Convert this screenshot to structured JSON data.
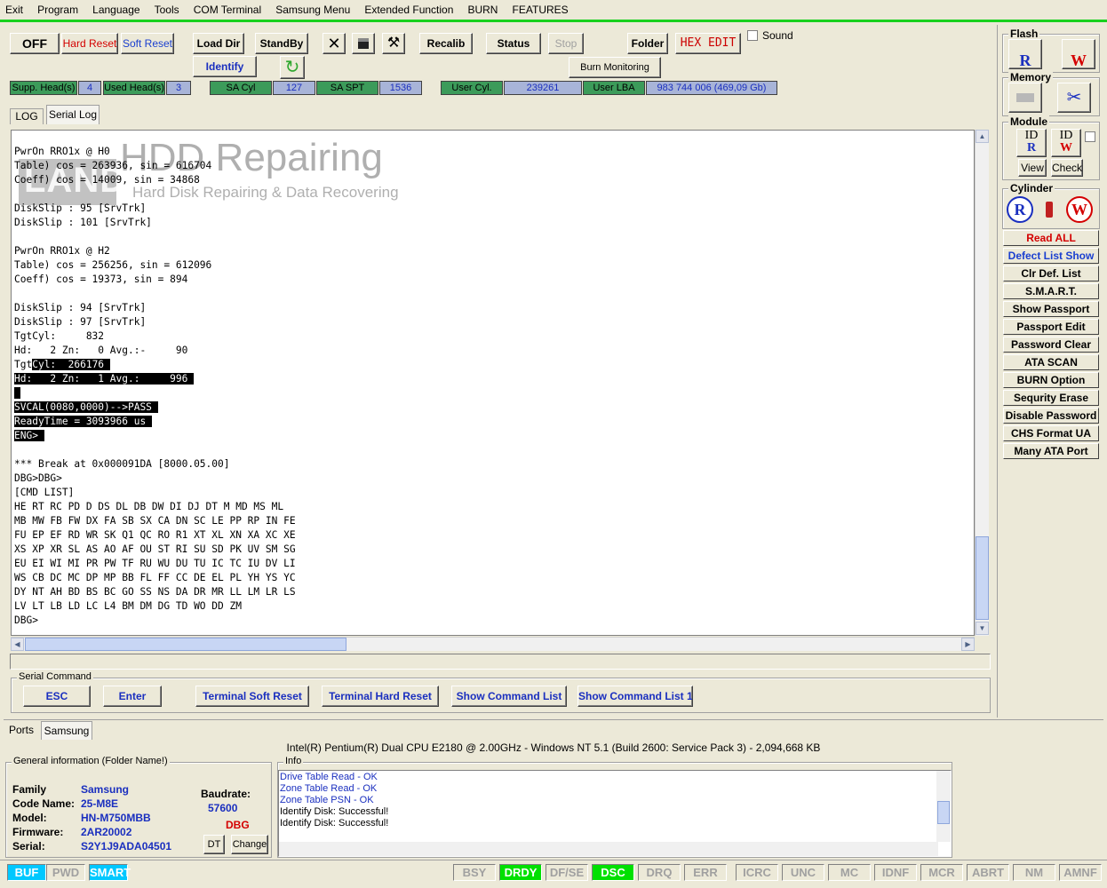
{
  "menu": [
    "Exit",
    "Program",
    "Language",
    "Tools",
    "COM Terminal",
    "Samsung Menu",
    "Extended Function",
    "BURN",
    "FEATURES"
  ],
  "toolbar": {
    "off": "OFF",
    "hard_reset": "Hard Reset",
    "soft_reset": "Soft Reset",
    "load_dir": "Load Dir",
    "identify": "Identify",
    "standby": "StandBy",
    "recalib": "Recalib",
    "status": "Status",
    "stop": "Stop",
    "folder": "Folder",
    "hex_edit": "HEX EDIT",
    "burn_monitoring": "Burn Monitoring",
    "sound": "Sound"
  },
  "params": {
    "supp_heads_label": "Supp. Head(s)",
    "supp_heads": "4",
    "used_heads_label": "Used Head(s)",
    "used_heads": "3",
    "sa_cyl_label": "SA Cyl",
    "sa_cyl": "127",
    "sa_spt_label": "SA SPT",
    "sa_spt": "1536",
    "user_cyl_label": "User Cyl.",
    "user_cyl": "239261",
    "user_lba_label": "User LBA",
    "user_lba": "983 744 006  (469,09 Gb)"
  },
  "tabs": {
    "log": "LOG",
    "serial_log": "Serial Log",
    "ports": "Ports",
    "samsung": "Samsung"
  },
  "watermark": {
    "line1": "HDD Repairing",
    "line2": "Hard Disk Repairing & Data Recovering",
    "logo": "LAND"
  },
  "terminal": [
    {
      "t": "PwrOn RRO1x @ H0"
    },
    {
      "t": "Table) cos = 263936, sin = 616704"
    },
    {
      "t": "Coeff) cos = 14009, sin = 34868"
    },
    {
      "t": ""
    },
    {
      "t": "DiskSlip : 95 [SrvTrk]"
    },
    {
      "t": "DiskSlip : 101 [SrvTrk]"
    },
    {
      "t": ""
    },
    {
      "t": "PwrOn RRO1x @ H2"
    },
    {
      "t": "Table) cos = 256256, sin = 612096"
    },
    {
      "t": "Coeff) cos = 19373, sin = 894"
    },
    {
      "t": ""
    },
    {
      "t": "DiskSlip : 94 [SrvTrk]"
    },
    {
      "t": "DiskSlip : 97 [SrvTrk]"
    },
    {
      "t": "TgtCyl:     832"
    },
    {
      "t": "Hd:   2 Zn:   0 Avg.:-     90"
    },
    {
      "pre": "Tgt",
      "t": "Cyl:  266176 "
    },
    {
      "pre": "",
      "t": "Hd:   2 Zn:   1 Avg.:     996 "
    },
    {
      "pre": "",
      "t": " "
    },
    {
      "pre": "",
      "t": "SVCAL(0080,0000)-->PASS "
    },
    {
      "pre": "",
      "t": "ReadyTime = 3093966 us "
    },
    {
      "pre": "",
      "t": "ENG> "
    },
    {
      "t": ""
    },
    {
      "t": "*** Break at 0x000091DA [8000.05.00]"
    },
    {
      "t": "DBG>DBG>"
    },
    {
      "t": "[CMD LIST]"
    },
    {
      "t": "HE RT RC PD D DS DL DB DW DI DJ DT M MD MS ML"
    },
    {
      "t": "MB MW FB FW DX FA SB SX CA DN SC LE PP RP IN FE"
    },
    {
      "t": "FU EP EF RD WR SK Q1 QC RO R1 XT XL XN XA XC XE"
    },
    {
      "t": "XS XP XR SL AS AO AF OU ST RI SU SD PK UV SM SG"
    },
    {
      "t": "EU EI WI MI PR PW TF RU WU DU TU IC TC IU DV LI"
    },
    {
      "t": "WS CB DC MC DP MP BB FL FF CC DE EL PL YH YS YC"
    },
    {
      "t": "DY NT AH BD BS BC GO SS NS DA DR MR LL LM LR LS"
    },
    {
      "t": "LV LT LB LD LC L4 BM DM DG TD WO DD ZM"
    },
    {
      "t": "DBG>"
    }
  ],
  "serial_command": {
    "title": "Serial Command",
    "esc": "ESC",
    "enter": "Enter",
    "soft_reset": "Terminal Soft Reset",
    "hard_reset": "Terminal Hard Reset",
    "show_cmd": "Show Command List",
    "show_cmd1": "Show Command List 1"
  },
  "sidebar": {
    "flash": "Flash",
    "memory": "Memory",
    "module": "Module",
    "cylinder": "Cylinder",
    "id": "ID",
    "view": "View",
    "check": "Check",
    "buttons": [
      "Read ALL",
      "Defect List Show",
      "Clr Def. List",
      "S.M.A.R.T.",
      "Show Passport",
      "Passport Edit",
      "Password Clear",
      "ATA SCAN",
      "BURN Option",
      "Sequrity Erase",
      "Disable Password",
      "CHS Format UA",
      "Many ATA Port"
    ],
    "colors": [
      "#d40000",
      "#1a3fd0",
      "#000",
      "#000",
      "#000",
      "#000",
      "#000",
      "#000",
      "#000",
      "#000",
      "#000",
      "#000",
      "#000"
    ]
  },
  "sysinfo": "Intel(R) Pentium(R) Dual  CPU  E2180  @ 2.00GHz - Windows NT 5.1 (Build 2600: Service Pack 3) -  2,094,668 KB",
  "general": {
    "title": "General information (Folder Name!)",
    "family_label": "Family",
    "family": "Samsung",
    "code_label": "Code Name:",
    "code": "25-M8E",
    "model_label": "Model:",
    "model": "HN-M750MBB",
    "firmware_label": "Firmware:",
    "firmware": "2AR20002",
    "serial_label": "Serial:",
    "serial": "S2Y1J9ADA04501",
    "baud_label": "Baudrate:",
    "baud": "57600",
    "mode": "DBG",
    "dt": "DT",
    "change": "Change"
  },
  "info": {
    "title": "Info",
    "lines": [
      {
        "t": "Drive Table Read - OK",
        "c": "#1a2fbf"
      },
      {
        "t": "Zone Table Read - OK",
        "c": "#1a2fbf"
      },
      {
        "t": "Zone Table PSN - OK",
        "c": "#1a2fbf"
      },
      {
        "t": "Identify Disk: Successful!",
        "c": "#000"
      },
      {
        "t": "Identify Disk: Successful!",
        "c": "#000"
      }
    ]
  },
  "status_left": [
    "BUF",
    "PWD",
    "SMART"
  ],
  "status_right": [
    "BSY",
    "DRDY",
    "DF/SE",
    "DSC",
    "DRQ",
    "ERR",
    "ICRC",
    "UNC",
    "MC",
    "IDNF",
    "MCR",
    "ABRT",
    "NM",
    "AMNF"
  ],
  "status_active": {
    "BUF": "#00c8ff",
    "SMART": "#00c8ff",
    "DRDY": "#00e000",
    "DSC": "#00e000"
  }
}
